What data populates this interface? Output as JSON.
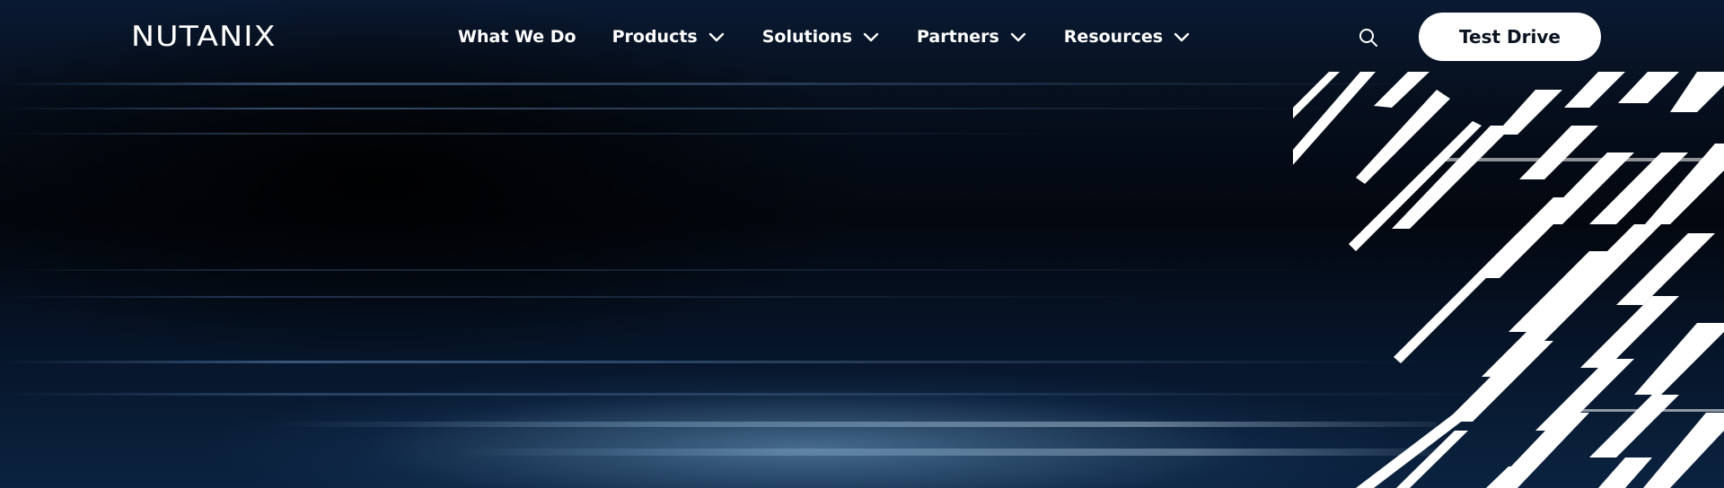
{
  "brand": {
    "logo_text": "NUTANIX"
  },
  "nav": {
    "items": [
      {
        "label": "What We Do",
        "has_dropdown": false
      },
      {
        "label": "Products",
        "has_dropdown": true
      },
      {
        "label": "Solutions",
        "has_dropdown": true
      },
      {
        "label": "Partners",
        "has_dropdown": true
      },
      {
        "label": "Resources",
        "has_dropdown": true
      }
    ],
    "search_icon": "search-icon",
    "cta_label": "Test Drive"
  },
  "colors": {
    "background": "#020611",
    "text": "#ffffff",
    "cta_background": "#ffffff",
    "cta_text": "#0b1220"
  }
}
